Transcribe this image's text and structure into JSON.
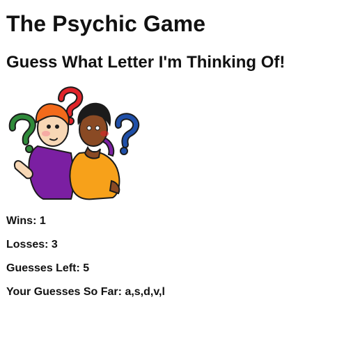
{
  "game": {
    "title": "The Psychic Game",
    "subtitle": "Guess What Letter I'm Thinking Of!",
    "image_icon": "thinking-kids-question-marks-clipart"
  },
  "stats": {
    "wins_label": "Wins:",
    "wins_value": "1",
    "losses_label": "Losses:",
    "losses_value": "3",
    "guesses_left_label": "Guesses Left:",
    "guesses_left_value": "5",
    "guesses_so_far_label": "Your Guesses So Far:",
    "guesses_so_far_value": "a,s,d,v,l"
  },
  "colors": {
    "text": "#111111",
    "background": "#ffffff",
    "question_red": "#e0242a",
    "question_green": "#2f8a3a",
    "question_blue": "#1f4fa8",
    "shirt_purple": "#7b1fa2",
    "shirt_orange": "#f7a11a"
  }
}
